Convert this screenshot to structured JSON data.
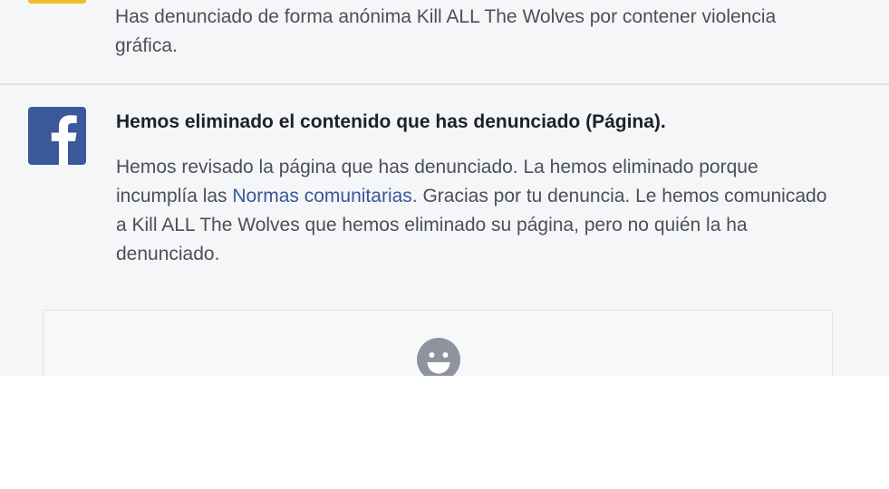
{
  "previous_notification": {
    "text": "Has denunciado de forma anónima Kill ALL The Wolves por contener violencia gráfica."
  },
  "notification": {
    "icon": "facebook-logo-icon",
    "title": "Hemos eliminado el contenido que has denunciado (Página).",
    "body_part1": "Hemos revisado la página que has denunciado. La hemos eliminado porque incumplía las ",
    "link_text": "Normas comunitarias",
    "body_part2": ". Gracias por tu denuncia. Le hemos comunicado a Kill ALL The Wolves que hemos eliminado su página, pero no quién la ha denunciado."
  },
  "feedback": {
    "icon": "smiley-face-icon"
  },
  "colors": {
    "background": "#f5f6f8",
    "facebook_blue": "#3b5998",
    "link": "#365899",
    "body_text": "#4b4f56",
    "title_text": "#1d2129",
    "divider": "#dddfe2"
  }
}
